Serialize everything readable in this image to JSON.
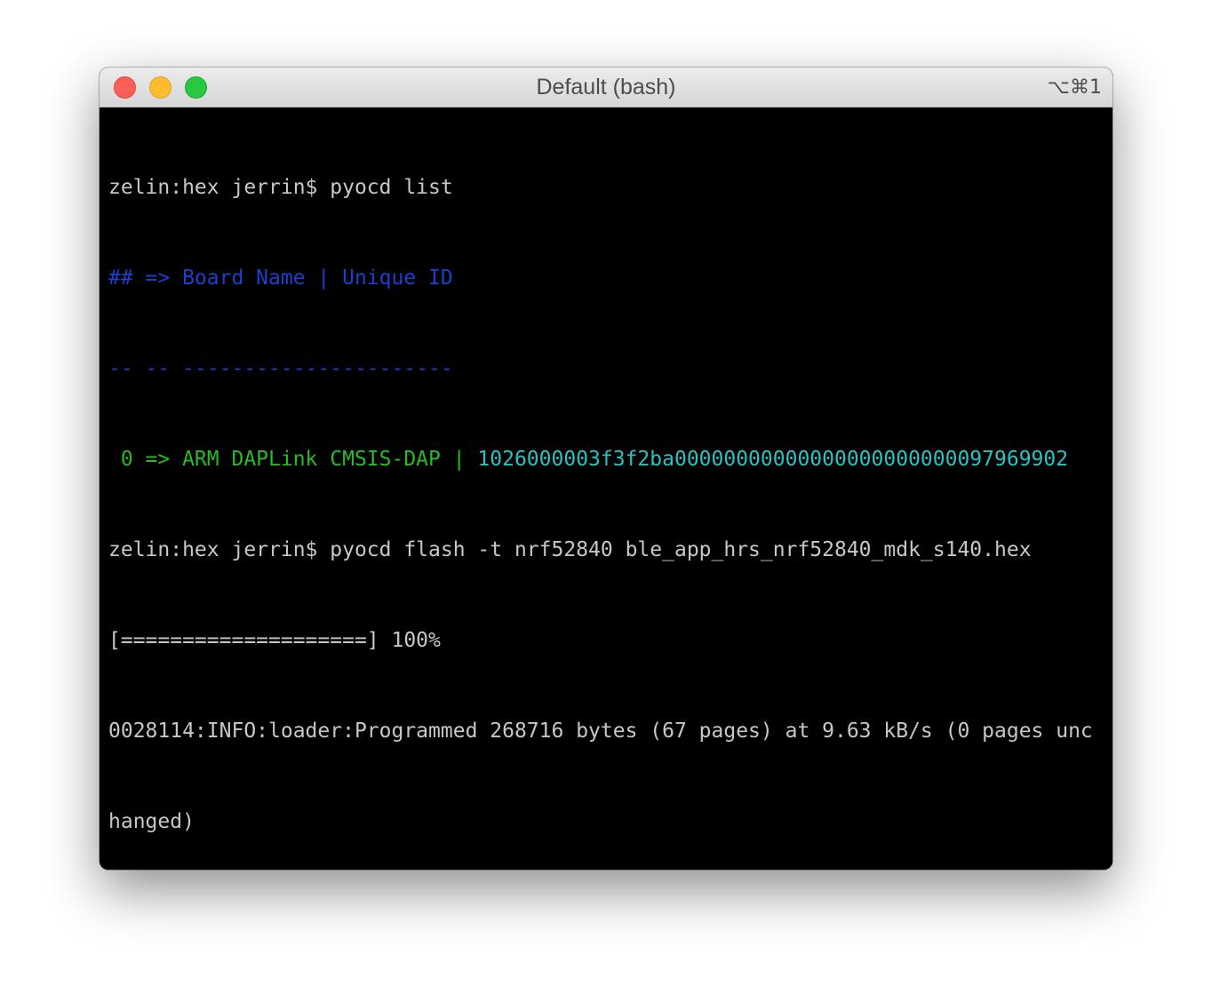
{
  "window": {
    "title": "Default (bash)",
    "shortcut": "⌥⌘1"
  },
  "terminal": {
    "prompt": "zelin:hex jerrin$ ",
    "cmd1": "pyocd list",
    "header": "## => Board Name | Unique ID",
    "separator": "-- -- ----------------------",
    "row_prefix": " 0 => ARM DAPLink CMSIS-DAP | ",
    "row_id": "1026000003f3f2ba00000000000000000000000097969902",
    "cmd2": "pyocd flash -t nrf52840 ble_app_hrs_nrf52840_mdk_s140.hex",
    "progress": "[====================] 100%",
    "info_line1": "0028114:INFO:loader:Programmed 268716 bytes (67 pages) at 9.63 kB/s (0 pages unc",
    "info_line2": "hanged)"
  },
  "colors": {
    "blue": "#1a3fd1",
    "green": "#25bc24",
    "cyan": "#2ac2c2",
    "text": "#c7c7c7",
    "background": "#000000"
  }
}
